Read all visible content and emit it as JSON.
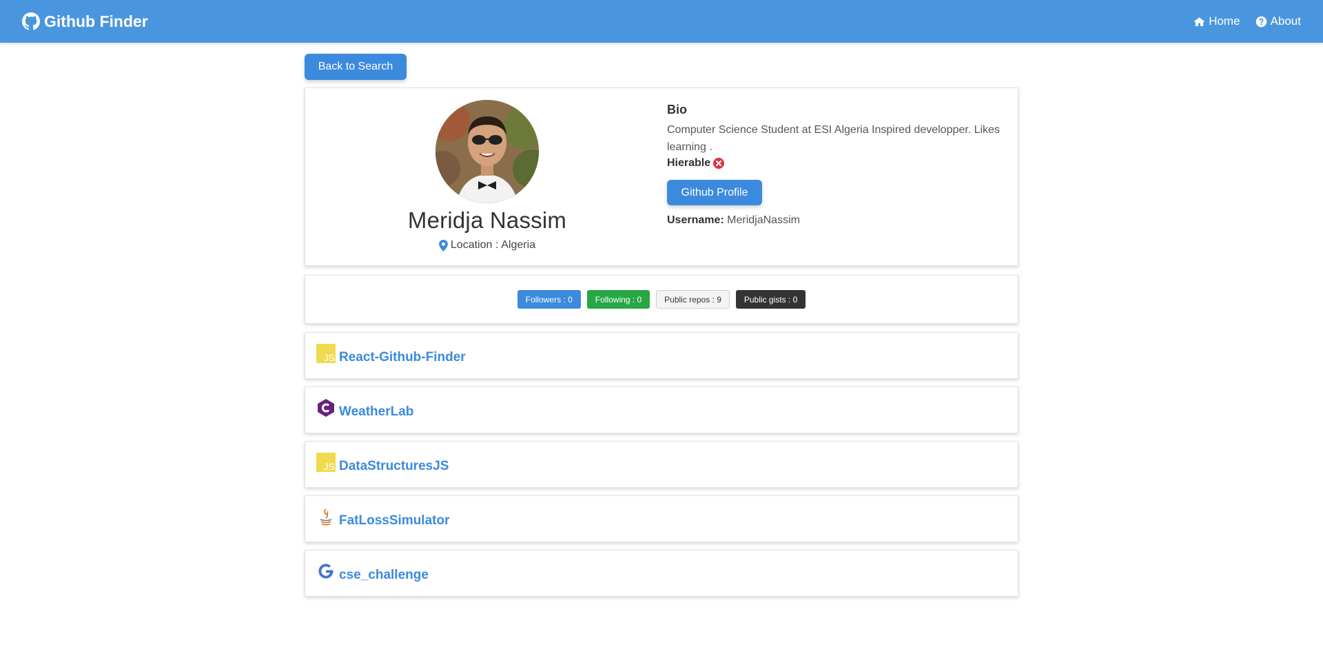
{
  "navbar": {
    "brand": "Github Finder",
    "brand_icon": "github-icon",
    "links": [
      {
        "label": "Home",
        "icon": "home-icon"
      },
      {
        "label": "About",
        "icon": "question-circle-icon"
      }
    ],
    "color": "#4a96de"
  },
  "back_button": {
    "label": "Back to Search"
  },
  "profile": {
    "name": "Meridja Nassim",
    "location_prefix": "Location : ",
    "location": "Algeria",
    "bio_heading": "Bio",
    "bio": "Computer Science Student at ESI Algeria Inspired developper. Likes learning .",
    "hireable_label": "Hierable",
    "hireable_icon": "times-circle-icon",
    "github_button": "Github Profile",
    "username_label": "Username:",
    "username": "MeridjaNassim"
  },
  "stats": [
    {
      "label": "Followers : 0",
      "style": "primary"
    },
    {
      "label": "Following : 0",
      "style": "success"
    },
    {
      "label": "Public repos : 9",
      "style": "light"
    },
    {
      "label": "Public gists : 0",
      "style": "dark"
    }
  ],
  "repos": [
    {
      "name": "React-Github-Finder",
      "language_icon": "javascript-icon"
    },
    {
      "name": "WeatherLab",
      "language_icon": "csharp-icon"
    },
    {
      "name": "DataStructuresJS",
      "language_icon": "javascript-icon"
    },
    {
      "name": "FatLossSimulator",
      "language_icon": "java-icon"
    },
    {
      "name": "cse_challenge",
      "language_icon": "google-icon"
    }
  ],
  "colors": {
    "accent": "#3b8ade",
    "success": "#28a745",
    "dark": "#333333",
    "danger": "#dc3545"
  }
}
